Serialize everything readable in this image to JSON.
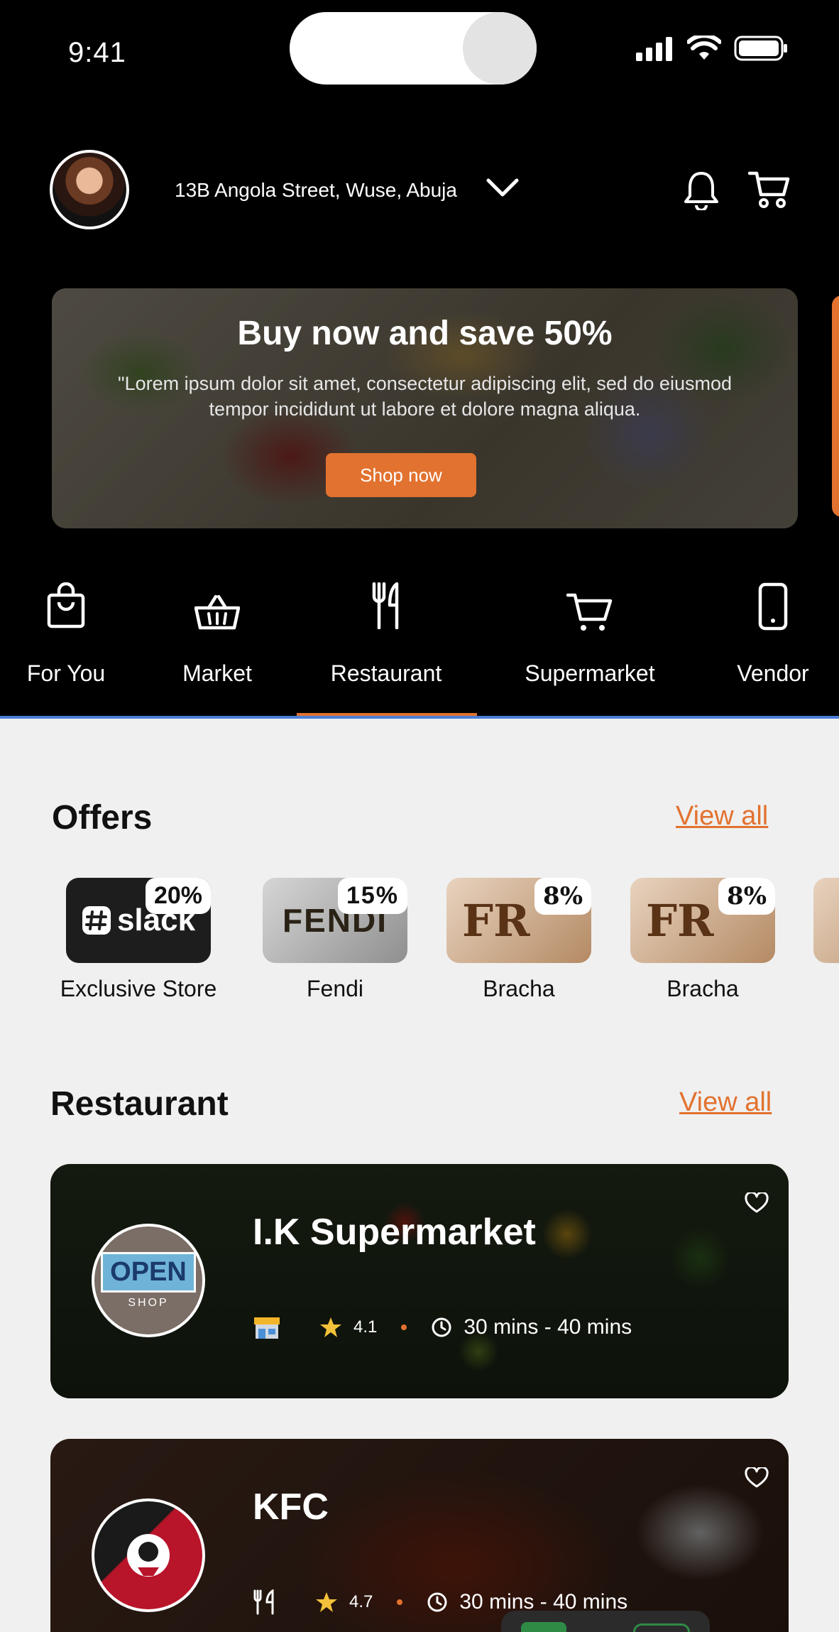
{
  "status_bar": {
    "time": "9:41"
  },
  "header": {
    "address": "13B Angola Street, Wuse, Abuja"
  },
  "banner": {
    "title": "Buy now and save 50%",
    "text": "\"Lorem ipsum dolor sit amet, consectetur adipiscing elit, sed do eiusmod tempor incididunt ut labore et dolore magna aliqua.",
    "button": "Shop now"
  },
  "categories": [
    {
      "label": "For You",
      "icon": "shopping-bag-icon"
    },
    {
      "label": "Market",
      "icon": "basket-icon"
    },
    {
      "label": "Restaurant",
      "icon": "fork-knife-icon",
      "selected": true
    },
    {
      "label": "Supermarket",
      "icon": "cart-icon"
    },
    {
      "label": "Vendor",
      "icon": "phone-icon"
    }
  ],
  "offers": {
    "title": "Offers",
    "view_all": "View all",
    "items": [
      {
        "name": "Exclusive Store",
        "discount": "20%",
        "brand": "slack"
      },
      {
        "name": "Fendi",
        "discount": "15%",
        "brand": "FENDI"
      },
      {
        "name": "Bracha",
        "discount": "8%",
        "brand": "FR"
      },
      {
        "name": "Bracha",
        "discount": "8%",
        "brand": "FR"
      }
    ]
  },
  "restaurants": {
    "title": "Restaurant",
    "view_all": "View all",
    "items": [
      {
        "name": "I.K Supermarket",
        "rating": "4.1",
        "time": "30 mins - 40 mins",
        "logo_text": "OPEN",
        "logo_sub": "SHOP"
      },
      {
        "name": "KFC",
        "rating": "4.7",
        "time": "30 mins - 40 mins"
      }
    ]
  },
  "colors": {
    "accent": "#e2722f",
    "tab_border": "#4a7fd8",
    "background": "#f0f0f0"
  }
}
